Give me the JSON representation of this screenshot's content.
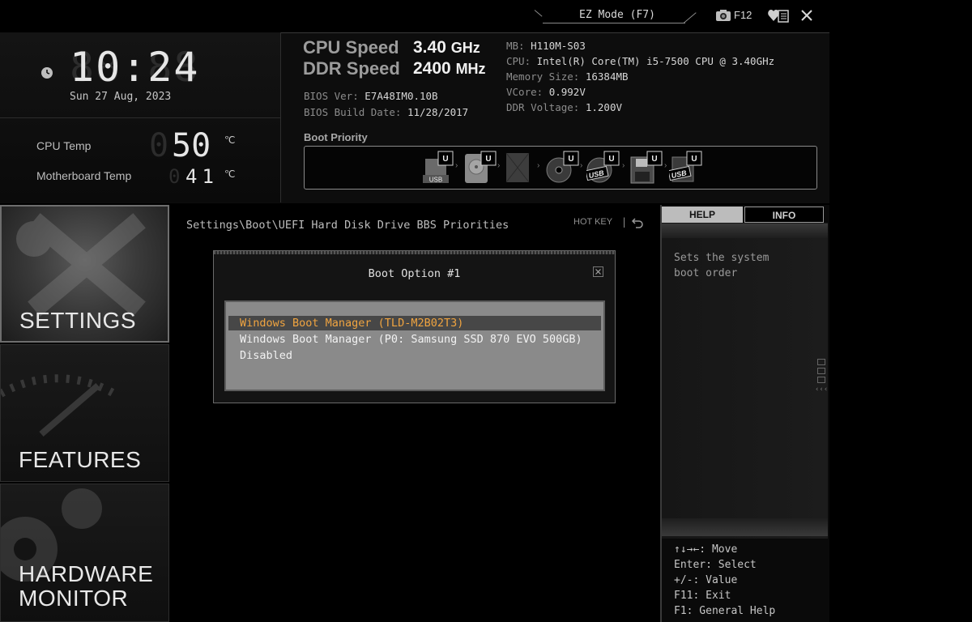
{
  "topbar": {
    "ez_mode": "EZ Mode (F7)",
    "screenshot_key": "F12"
  },
  "clock": {
    "time": "10:24",
    "date": "Sun  27 Aug, 2023"
  },
  "temps": {
    "cpu_label": "CPU Temp",
    "cpu_value": "50",
    "mb_label": "Motherboard Temp",
    "mb_value": "41",
    "unit": "℃"
  },
  "speeds": {
    "cpu_label": "CPU Speed",
    "cpu_value": "3.40",
    "cpu_unit": "GHz",
    "ddr_label": "DDR Speed",
    "ddr_value": "2400",
    "ddr_unit": "MHz"
  },
  "bios": {
    "ver_label": "BIOS Ver:",
    "ver_value": "E7A48IM0.10B",
    "date_label": "BIOS Build Date:",
    "date_value": "11/28/2017"
  },
  "system": {
    "mb_label": "MB:",
    "mb_value": "H110M-S03",
    "cpu_label": "CPU:",
    "cpu_value": "Intel(R) Core(TM) i5-7500 CPU @ 3.40GHz",
    "mem_label": "Memory Size:",
    "mem_value": "16384MB",
    "vcore_label": "VCore:",
    "vcore_value": "0.992V",
    "ddrv_label": "DDR Voltage:",
    "ddrv_value": "1.200V"
  },
  "boot_priority": {
    "title": "Boot Priority",
    "devices": [
      {
        "type": "usb-drive",
        "badge": "U",
        "label": "USB"
      },
      {
        "type": "hard-disk",
        "badge": "U",
        "label": ""
      },
      {
        "type": "blank-disk",
        "badge": "",
        "label": ""
      },
      {
        "type": "optical-disc",
        "badge": "U",
        "label": ""
      },
      {
        "type": "usb-optical",
        "badge": "U",
        "label": "USB"
      },
      {
        "type": "floppy",
        "badge": "U",
        "label": ""
      },
      {
        "type": "usb-floppy",
        "badge": "U",
        "label": "USB"
      }
    ]
  },
  "nav": {
    "settings": "SETTINGS",
    "features": "FEATURES",
    "hw_line1": "HARDWARE",
    "hw_line2": "MONITOR"
  },
  "main": {
    "breadcrumb": "Settings\\Boot\\UEFI Hard Disk Drive BBS Priorities",
    "hotkey": "HOT KEY",
    "hotkey_sep": "|"
  },
  "dialog": {
    "title": "Boot Option #1",
    "options": [
      "Windows Boot Manager (TLD-M2B02T3)",
      "Windows Boot Manager (P0: Samsung SSD 870 EVO 500GB)",
      "Disabled"
    ],
    "selected_index": 0
  },
  "help": {
    "tab_help": "HELP",
    "tab_info": "INFO",
    "text": "Sets the system\nboot order",
    "keys": [
      "↑↓→←: Move",
      "Enter: Select",
      "+/-: Value",
      "F11: Exit",
      "F1: General Help"
    ]
  },
  "colors": {
    "selected_option": "#f0a440",
    "background": "#000000",
    "panel": "#0d0d0d"
  }
}
